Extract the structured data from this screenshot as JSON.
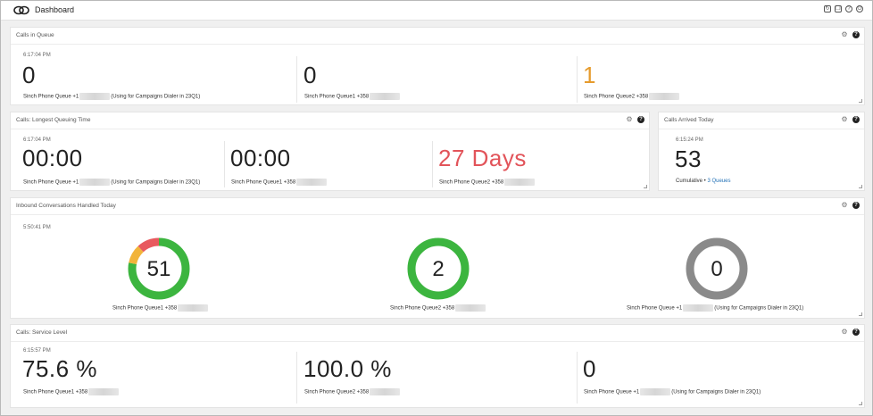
{
  "app": {
    "title": "Dashboard"
  },
  "topbar_icons": [
    "refresh-icon",
    "copy-icon",
    "help-circle-icon",
    "power-icon"
  ],
  "panels": {
    "calls_in_queue": {
      "title": "Calls in Queue",
      "timestamp": "6:17:04 PM",
      "cells": [
        {
          "value": "0",
          "label_a": "Sinch Phone Queue +1",
          "label_b": "(Using for Campaigns Dialer in 23Q1)"
        },
        {
          "value": "0",
          "label_a": "Sinch Phone Queue1 +358",
          "label_b": ""
        },
        {
          "value": "1",
          "label_a": "Sinch Phone Queue2 +358",
          "label_b": ""
        }
      ]
    },
    "longest_queuing": {
      "title": "Calls: Longest Queuing Time",
      "timestamp": "6:17:04 PM",
      "cells": [
        {
          "value": "00:00",
          "label_a": "Sinch Phone Queue +1",
          "label_b": "(Using for Campaigns Dialer in 23Q1)"
        },
        {
          "value": "00:00",
          "label_a": "Sinch Phone Queue1 +358",
          "label_b": ""
        },
        {
          "value": "27 Days",
          "label_a": "Sinch Phone Queue2 +358",
          "label_b": ""
        }
      ]
    },
    "arrived_today": {
      "title": "Calls Arrived Today",
      "timestamp": "6:15:24 PM",
      "value": "53",
      "cumulative_label": "Cumulative •",
      "queues_link": "3 Queues"
    },
    "inbound_handled": {
      "title": "Inbound Conversations Handled Today",
      "timestamp": "5:50:41 PM",
      "donuts": [
        {
          "value": "51",
          "label_a": "Sinch Phone Queue1 +358",
          "label_b": "",
          "segments": [
            {
              "fraction": 0.78,
              "color": "#3cb53f"
            },
            {
              "fraction": 0.1,
              "color": "#f2b43a"
            },
            {
              "fraction": 0.12,
              "color": "#e85a5f"
            }
          ]
        },
        {
          "value": "2",
          "label_a": "Sinch Phone Queue2 +358",
          "label_b": "",
          "segments": [
            {
              "fraction": 1.0,
              "color": "#3cb53f"
            }
          ]
        },
        {
          "value": "0",
          "label_a": "Sinch Phone Queue +1",
          "label_b": "(Using for Campaigns Dialer in 23Q1)",
          "segments": [
            {
              "fraction": 1.0,
              "color": "#8a8a8a"
            }
          ]
        }
      ]
    },
    "service_level": {
      "title": "Calls: Service Level",
      "timestamp": "6:15:57 PM",
      "cells": [
        {
          "value": "75.6 %",
          "label_a": "Sinch Phone Queue1 +358",
          "label_b": ""
        },
        {
          "value": "100.0 %",
          "label_a": "Sinch Phone Queue2 +358",
          "label_b": ""
        },
        {
          "value": "0",
          "label_a": "Sinch Phone Queue +1",
          "label_b": "(Using for Campaigns Dialer in 23Q1)"
        }
      ]
    }
  },
  "colors": {
    "orange_value": "#e69b2d",
    "red_value": "#e2545a",
    "link": "#1f6fb5"
  }
}
